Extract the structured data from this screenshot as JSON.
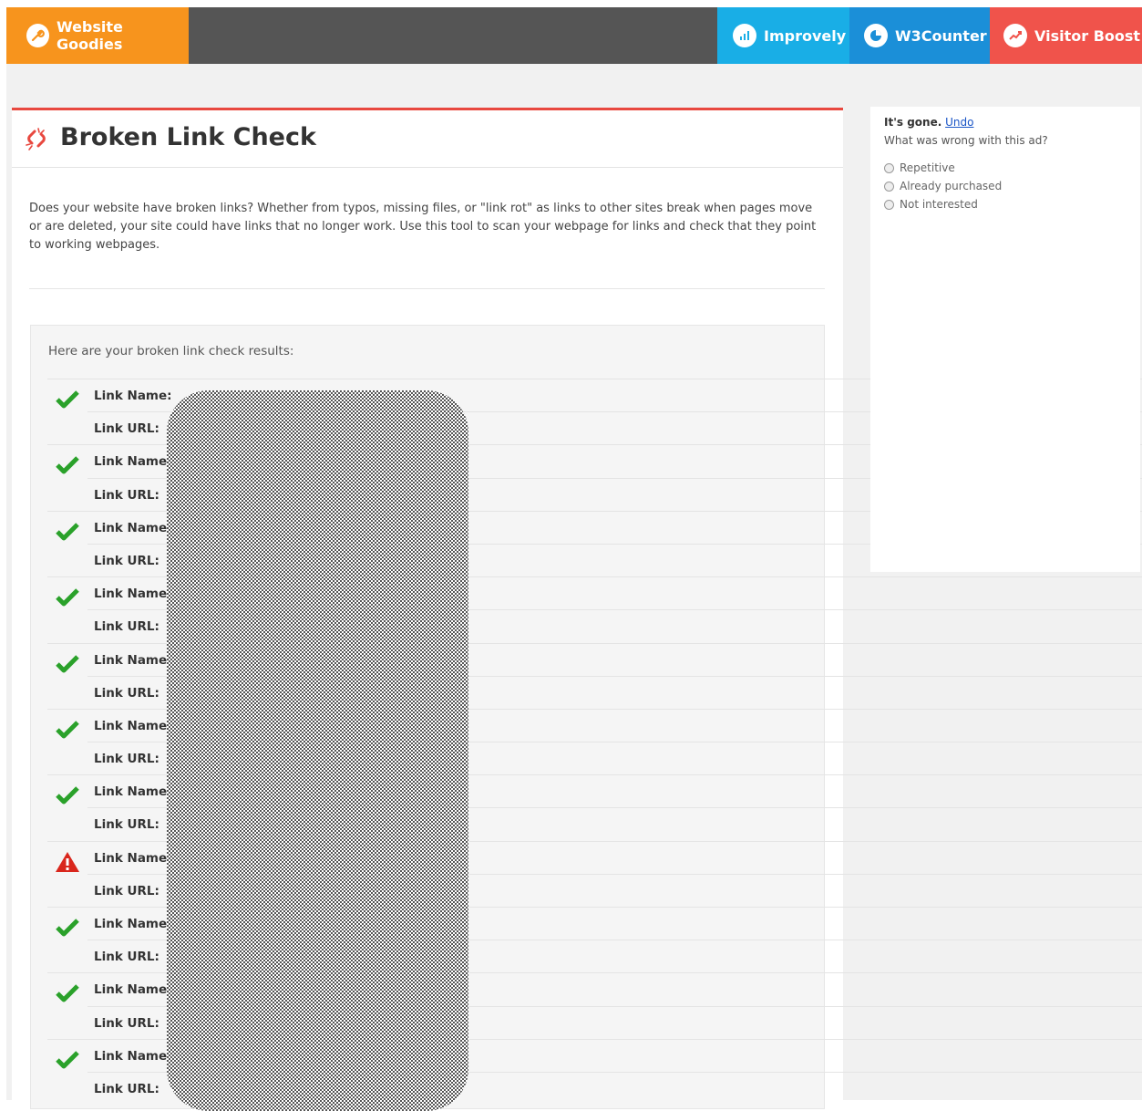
{
  "nav": {
    "brand": "Website Goodies",
    "links": [
      "Improvely",
      "W3Counter",
      "Visitor Boost"
    ]
  },
  "page": {
    "title": "Broken Link Check",
    "description": "Does your website have broken links? Whether from typos, missing files, or \"link rot\" as links to other sites break when pages move or are deleted, your site could have links that no longer work. Use this tool to scan your webpage for links and check that they point to working webpages.",
    "results_heading": "Here are your broken link check results:",
    "link_name_label": "Link Name:",
    "link_url_label": "Link URL:",
    "results": [
      {
        "status": "ok"
      },
      {
        "status": "ok"
      },
      {
        "status": "ok"
      },
      {
        "status": "ok"
      },
      {
        "status": "ok"
      },
      {
        "status": "ok"
      },
      {
        "status": "ok"
      },
      {
        "status": "broken"
      },
      {
        "status": "ok"
      },
      {
        "status": "ok"
      },
      {
        "status": "ok"
      }
    ]
  },
  "ad_feedback": {
    "gone": "It's gone.",
    "undo": "Undo",
    "question": "What was wrong with this ad?",
    "options": [
      "Repetitive",
      "Already purchased",
      "Not interested"
    ]
  },
  "colors": {
    "ok": "#2aa12a",
    "broken": "#d9261c",
    "accent": "#e8483f"
  }
}
